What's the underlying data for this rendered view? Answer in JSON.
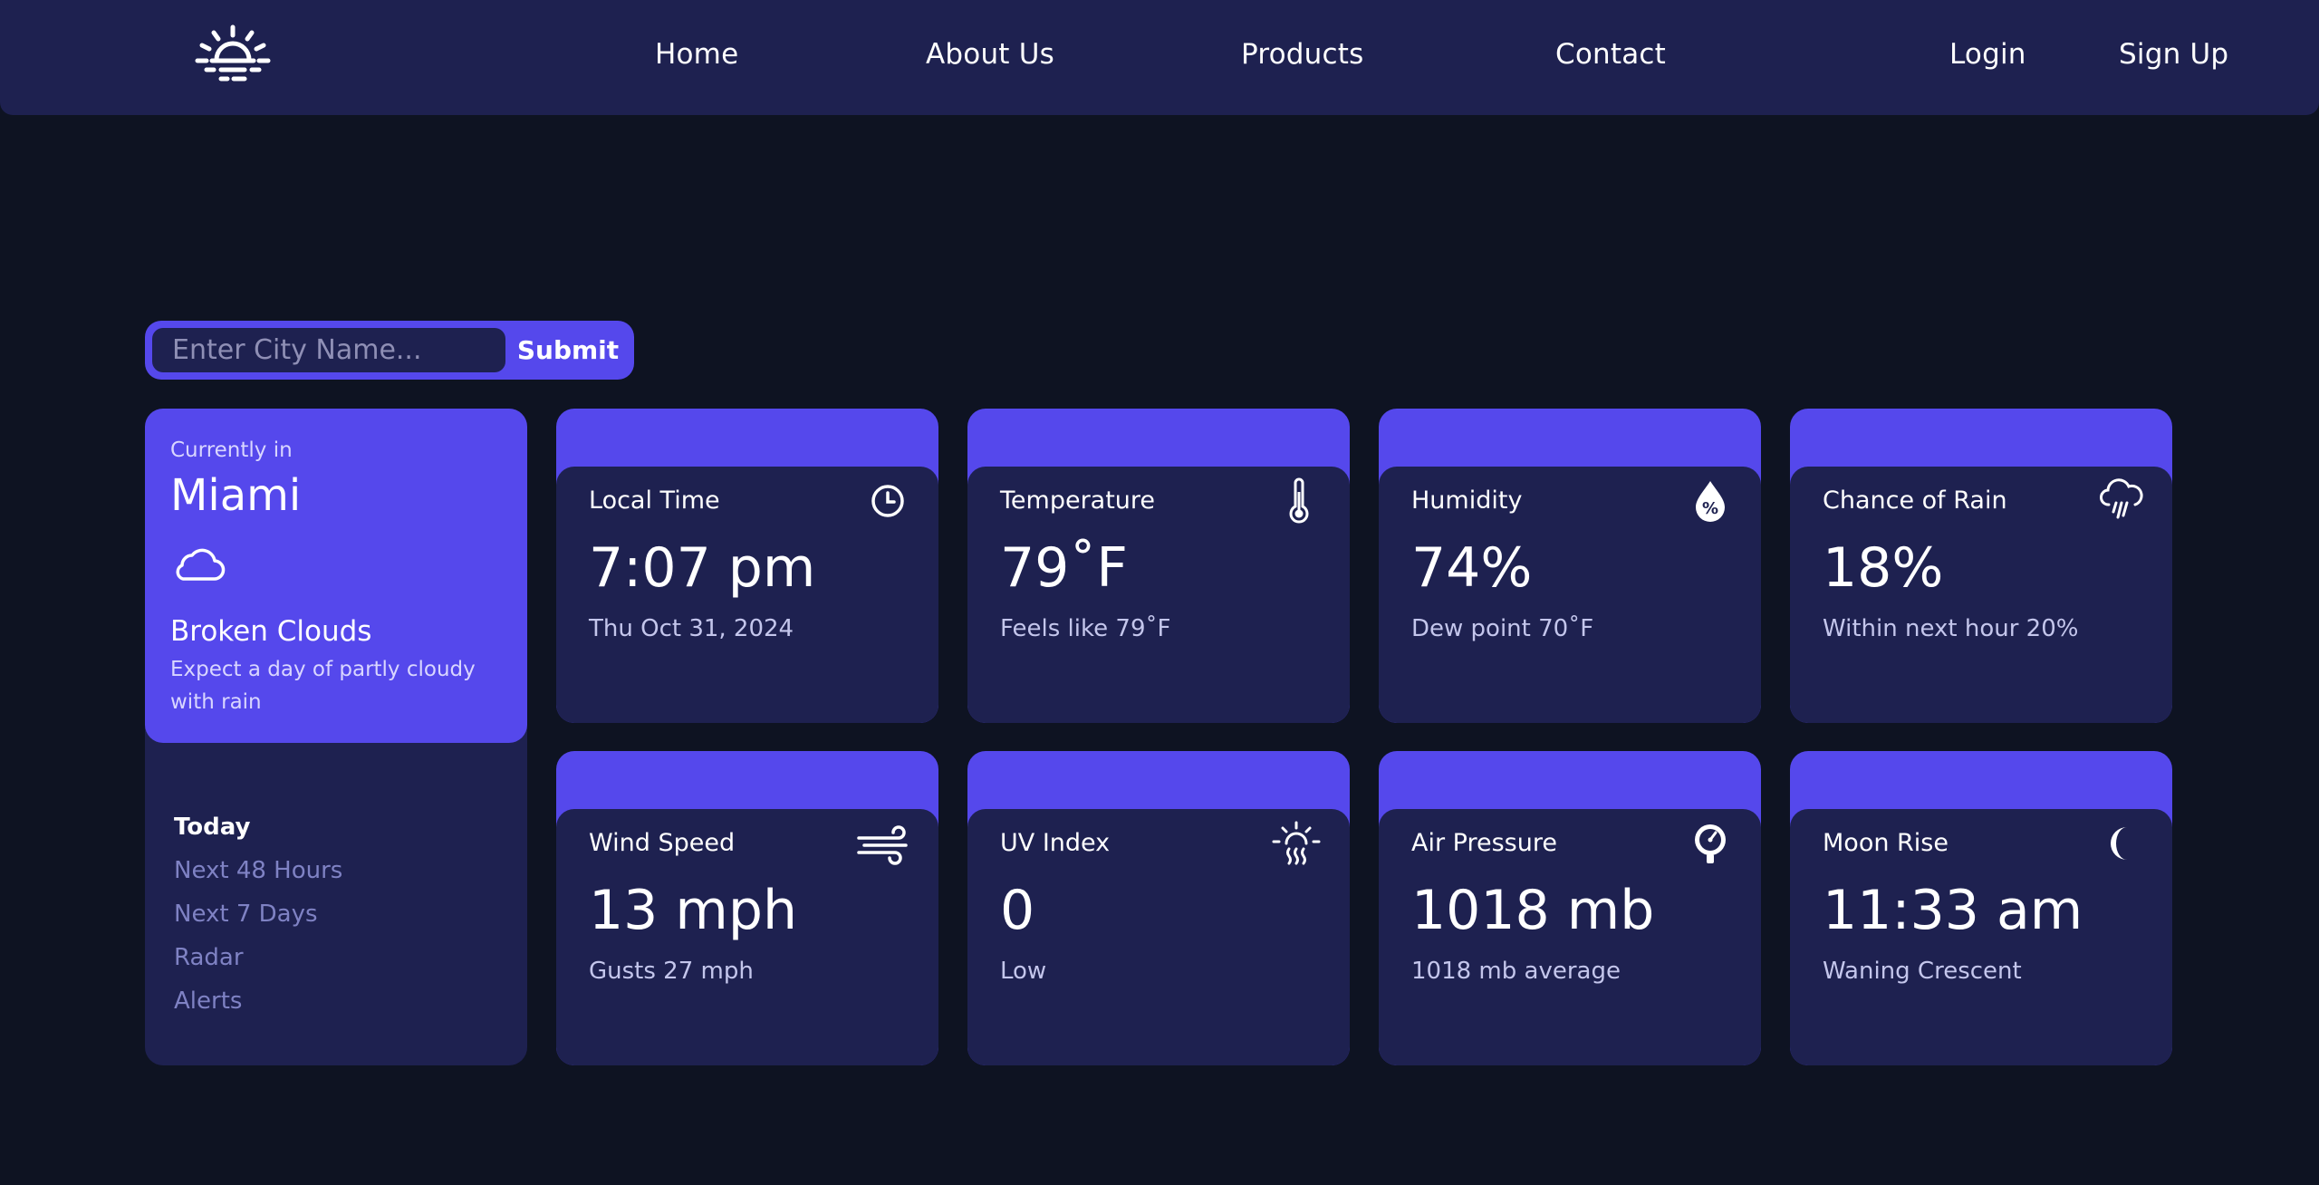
{
  "nav": {
    "logo_icon": "sunrise-icon",
    "links": [
      "Home",
      "About Us",
      "Products",
      "Contact"
    ],
    "login": "Login",
    "signup": "Sign Up"
  },
  "search": {
    "placeholder": "Enter City Name...",
    "value": "",
    "submit": "Submit"
  },
  "current": {
    "label": "Currently in",
    "city": "Miami",
    "icon": "cloud-icon",
    "condition": "Broken Clouds",
    "description": "Expect a day of partly cloudy with rain"
  },
  "forecast_nav": {
    "items": [
      "Today",
      "Next 48 Hours",
      "Next 7 Days",
      "Radar",
      "Alerts"
    ],
    "active": "Today"
  },
  "cards": [
    {
      "label": "Local Time",
      "icon": "clock-icon",
      "value": "7:07 pm",
      "sub": "Thu Oct 31, 2024"
    },
    {
      "label": "Temperature",
      "icon": "thermometer-icon",
      "value": "79˚F",
      "sub": "Feels like 79˚F"
    },
    {
      "label": "Humidity",
      "icon": "humidity-drop-icon",
      "value": "74%",
      "sub": "Dew point 70˚F"
    },
    {
      "label": "Chance of Rain",
      "icon": "rain-cloud-icon",
      "value": "18%",
      "sub": "Within next hour 20%"
    },
    {
      "label": "Wind Speed",
      "icon": "wind-icon",
      "value": "13 mph",
      "sub": "Gusts 27 mph"
    },
    {
      "label": "UV Index",
      "icon": "uv-sun-icon",
      "value": "0",
      "sub": "Low"
    },
    {
      "label": "Air Pressure",
      "icon": "pressure-gauge-icon",
      "value": "1018 mb",
      "sub": "1018 mb average"
    },
    {
      "label": "Moon Rise",
      "icon": "moon-icon",
      "value": "11:33 am",
      "sub": "Waning Crescent"
    }
  ],
  "colors": {
    "background": "#0e1322",
    "panel": "#1e2150",
    "accent": "#5548ec",
    "muted_link": "#7f82c4"
  }
}
